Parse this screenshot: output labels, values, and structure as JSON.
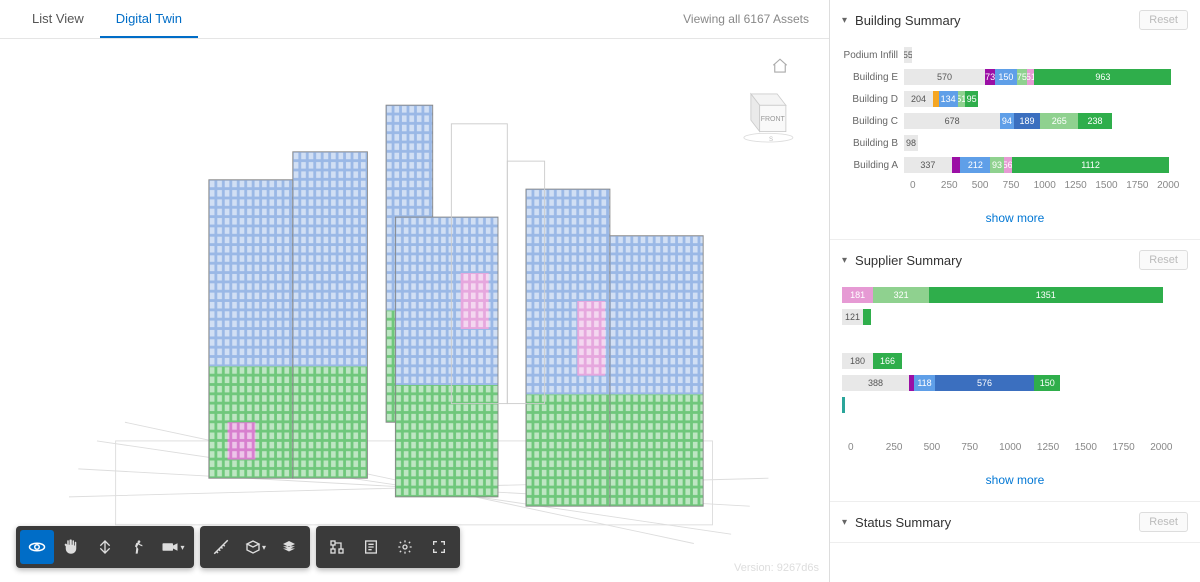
{
  "tabs": {
    "list": "List View",
    "twin": "Digital Twin"
  },
  "viewing": "Viewing all 6167 Assets",
  "version": "Version: 9267d6s",
  "toolbar": {
    "orbit": "orbit",
    "pan": "pan",
    "zoom": "zoom",
    "walk": "walk",
    "camera": "camera",
    "measure": "measure",
    "section": "section",
    "explode": "explode",
    "model_tree": "model-tree",
    "properties": "properties",
    "settings": "settings",
    "fullscreen": "fullscreen"
  },
  "panels": {
    "building": {
      "title": "Building Summary",
      "reset": "Reset",
      "show_more": "show more"
    },
    "supplier": {
      "title": "Supplier Summary",
      "reset": "Reset",
      "show_more": "show more"
    },
    "status": {
      "title": "Status Summary",
      "reset": "Reset"
    }
  },
  "axis_ticks": [
    "0",
    "250",
    "500",
    "750",
    "1000",
    "1250",
    "1500",
    "1750",
    "2000"
  ],
  "colors": {
    "grey": "#e8e8e8",
    "orange": "#f5a623",
    "purple": "#9b0fa5",
    "blue": "#5f9fe8",
    "lightgreen": "#8fd18f",
    "pink": "#e69ad4",
    "green": "#2fae4b",
    "darkblue": "#3b6fbf",
    "teal": "#2aa59a"
  },
  "chart_data": [
    {
      "id": "building_summary",
      "type": "bar",
      "orientation": "horizontal",
      "stacked": true,
      "xlim": [
        0,
        2000
      ],
      "xticks": [
        0,
        250,
        500,
        750,
        1000,
        1250,
        1500,
        1750,
        2000
      ],
      "categories": [
        "Podium Infill",
        "Building E",
        "Building D",
        "Building C",
        "Building B",
        "Building A"
      ],
      "rows": [
        {
          "label": "Podium Infill",
          "segments": [
            {
              "v": 55,
              "c": "grey",
              "lt": true
            }
          ]
        },
        {
          "label": "Building E",
          "segments": [
            {
              "v": 570,
              "c": "grey",
              "lt": true
            },
            {
              "v": 73,
              "c": "purple"
            },
            {
              "v": 150,
              "c": "blue"
            },
            {
              "v": 75,
              "c": "lightgreen"
            },
            {
              "v": 51,
              "c": "pink"
            },
            {
              "v": 963,
              "c": "green"
            }
          ]
        },
        {
          "label": "Building D",
          "segments": [
            {
              "v": 204,
              "c": "grey",
              "lt": true
            },
            {
              "v": 40,
              "c": "orange",
              "nolabel": true
            },
            {
              "v": 134,
              "c": "blue"
            },
            {
              "v": 51,
              "c": "lightgreen"
            },
            {
              "v": 95,
              "c": "green"
            }
          ]
        },
        {
          "label": "Building C",
          "segments": [
            {
              "v": 678,
              "c": "grey",
              "lt": true
            },
            {
              "v": 94,
              "c": "blue"
            },
            {
              "v": 189,
              "c": "darkblue"
            },
            {
              "v": 265,
              "c": "lightgreen"
            },
            {
              "v": 238,
              "c": "green"
            }
          ]
        },
        {
          "label": "Building B",
          "segments": [
            {
              "v": 98,
              "c": "grey",
              "lt": true
            }
          ]
        },
        {
          "label": "Building A",
          "segments": [
            {
              "v": 337,
              "c": "grey",
              "lt": true
            },
            {
              "v": 60,
              "c": "purple",
              "nolabel": true
            },
            {
              "v": 212,
              "c": "blue"
            },
            {
              "v": 93,
              "c": "lightgreen"
            },
            {
              "v": 56,
              "c": "pink"
            },
            {
              "v": 1112,
              "c": "green"
            }
          ]
        }
      ]
    },
    {
      "id": "supplier_summary",
      "type": "bar",
      "orientation": "horizontal",
      "stacked": true,
      "xlim": [
        0,
        2000
      ],
      "xticks": [
        0,
        250,
        500,
        750,
        1000,
        1250,
        1500,
        1750,
        2000
      ],
      "rows": [
        {
          "segments": [
            {
              "v": 181,
              "c": "pink"
            },
            {
              "v": 321,
              "c": "lightgreen"
            },
            {
              "v": 1351,
              "c": "green"
            }
          ]
        },
        {
          "segments": [
            {
              "v": 121,
              "c": "grey",
              "lt": true
            },
            {
              "v": 45,
              "c": "green",
              "nolabel": true
            }
          ]
        },
        {
          "segments": []
        },
        {
          "segments": [
            {
              "v": 180,
              "c": "grey",
              "lt": true
            },
            {
              "v": 166,
              "c": "green"
            }
          ]
        },
        {
          "segments": [
            {
              "v": 388,
              "c": "grey",
              "lt": true
            },
            {
              "v": 30,
              "c": "purple",
              "nolabel": true
            },
            {
              "v": 118,
              "c": "blue"
            },
            {
              "v": 576,
              "c": "darkblue"
            },
            {
              "v": 150,
              "c": "green"
            }
          ]
        },
        {
          "segments": [
            {
              "v": 15,
              "c": "teal",
              "nolabel": true
            }
          ]
        },
        {
          "segments": []
        }
      ]
    }
  ]
}
